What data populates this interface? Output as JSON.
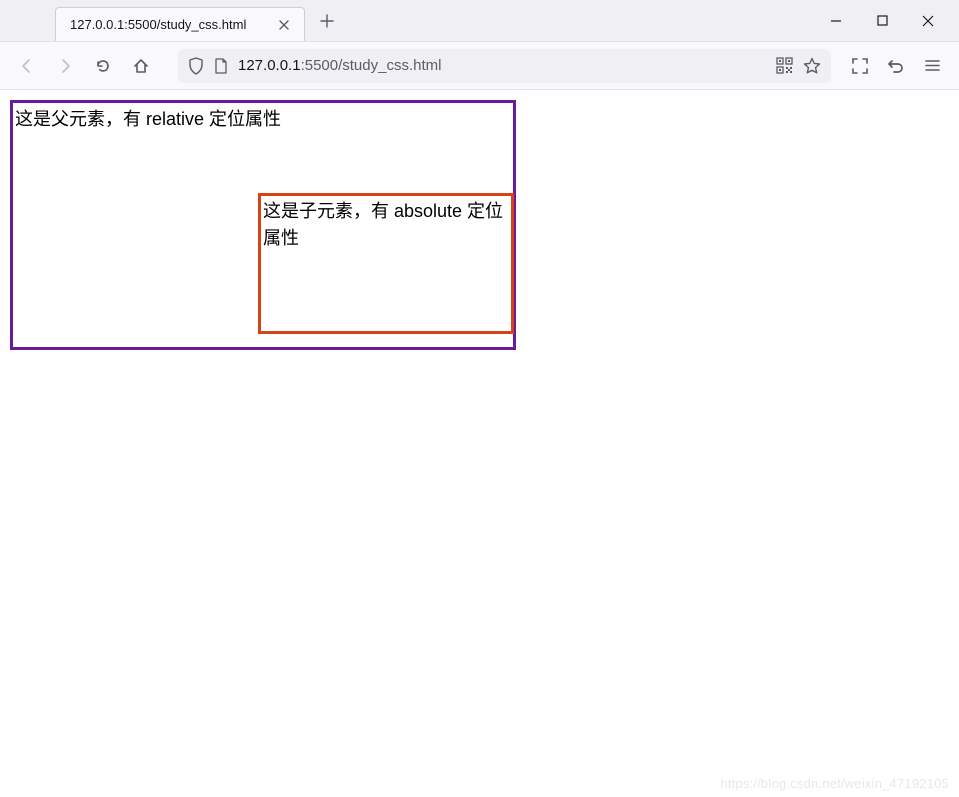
{
  "window": {
    "tab_title": "127.0.0.1:5500/study_css.html"
  },
  "addressbar": {
    "host": "127.0.0.1",
    "rest": ":5500/study_css.html"
  },
  "page": {
    "parent_text": "这是父元素，有 relative 定位属性",
    "child_text": "这是子元素，有 absolute 定位属性"
  },
  "watermark": "https://blog.csdn.net/weixin_47192105"
}
